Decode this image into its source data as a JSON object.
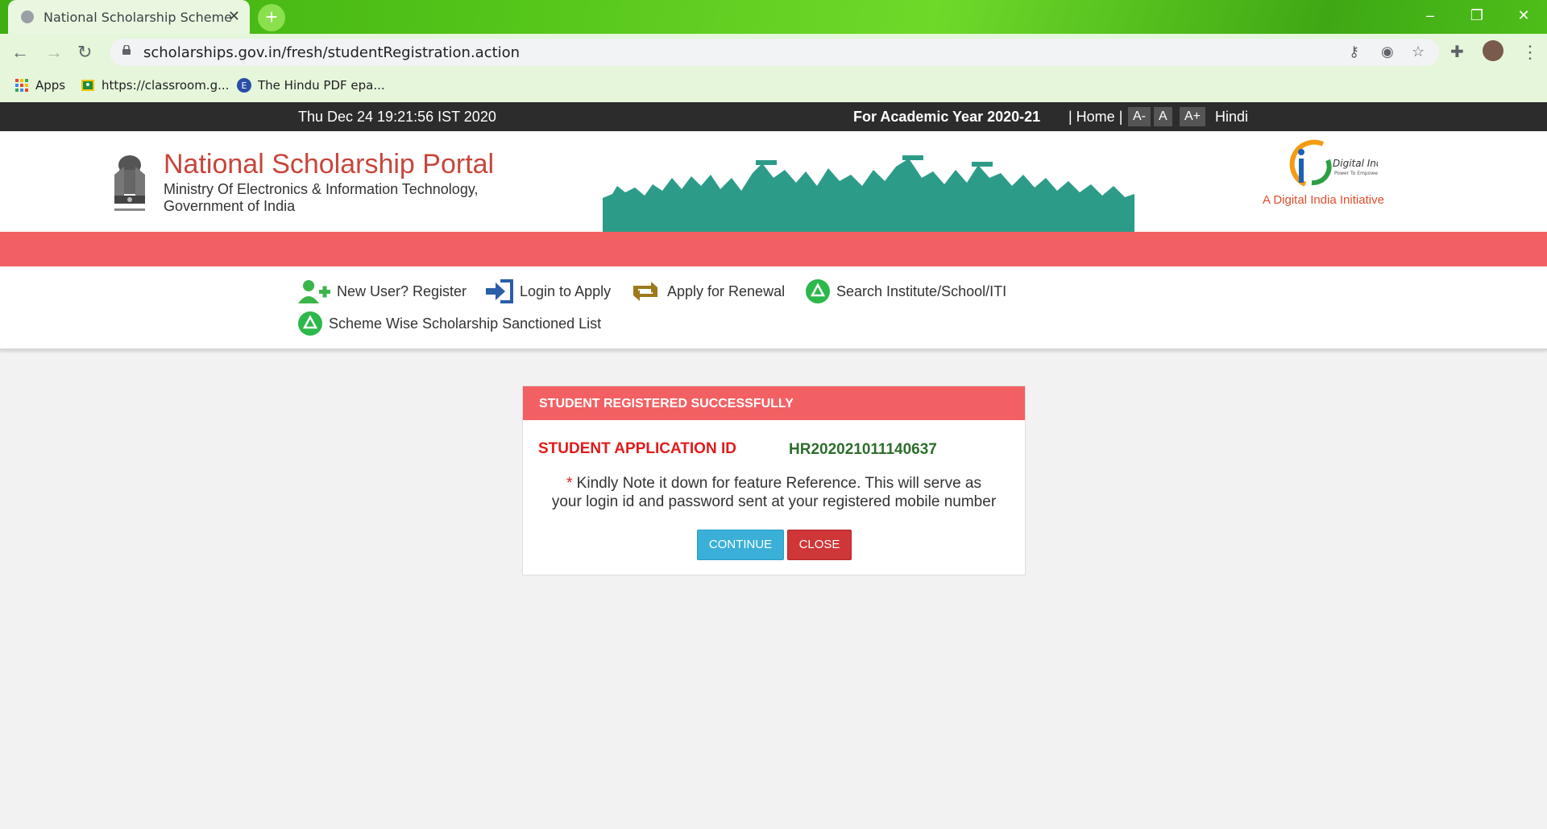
{
  "browser": {
    "tab_title": "National Scholarship Scheme",
    "url": "scholarships.gov.in/fresh/studentRegistration.action",
    "bookmarks": [
      {
        "label": "Apps"
      },
      {
        "label": "https://classroom.g..."
      },
      {
        "label": "The Hindu PDF epa..."
      }
    ]
  },
  "topbar": {
    "datetime": "Thu Dec 24 19:21:56 IST 2020",
    "academic_year": "For Academic Year 2020-21",
    "home": "| Home |",
    "font_minus": "A-",
    "font_normal": "A",
    "font_plus": "A+",
    "hindi": "Hindi"
  },
  "header": {
    "title": "National Scholarship Portal",
    "subtitle_line1": "Ministry Of Electronics & Information Technology,",
    "subtitle_line2": "Government of India",
    "digital_india_tag": "A Digital India Initiative"
  },
  "menu": {
    "register": "New User? Register",
    "login": "Login to Apply",
    "renewal": "Apply for Renewal",
    "search": "Search Institute/School/ITI",
    "sanctioned": "Scheme Wise Scholarship Sanctioned List"
  },
  "modal": {
    "title": "STUDENT REGISTERED SUCCESSFULLY",
    "id_label": "STUDENT APPLICATION ID",
    "id_value": "HR202021011140637",
    "note_star": "*",
    "note_line1": "Kindly Note it down for feature Reference. This will serve as",
    "note_line2": "your login id and password sent at your registered mobile number",
    "continue_label": "CONTINUE",
    "close_label": "CLOSE"
  },
  "colors": {
    "band_red": "#f36063",
    "title_red": "#c8453b",
    "id_green": "#2d6e2d",
    "continue_blue": "#3ab0d8",
    "close_red": "#cf3638"
  }
}
